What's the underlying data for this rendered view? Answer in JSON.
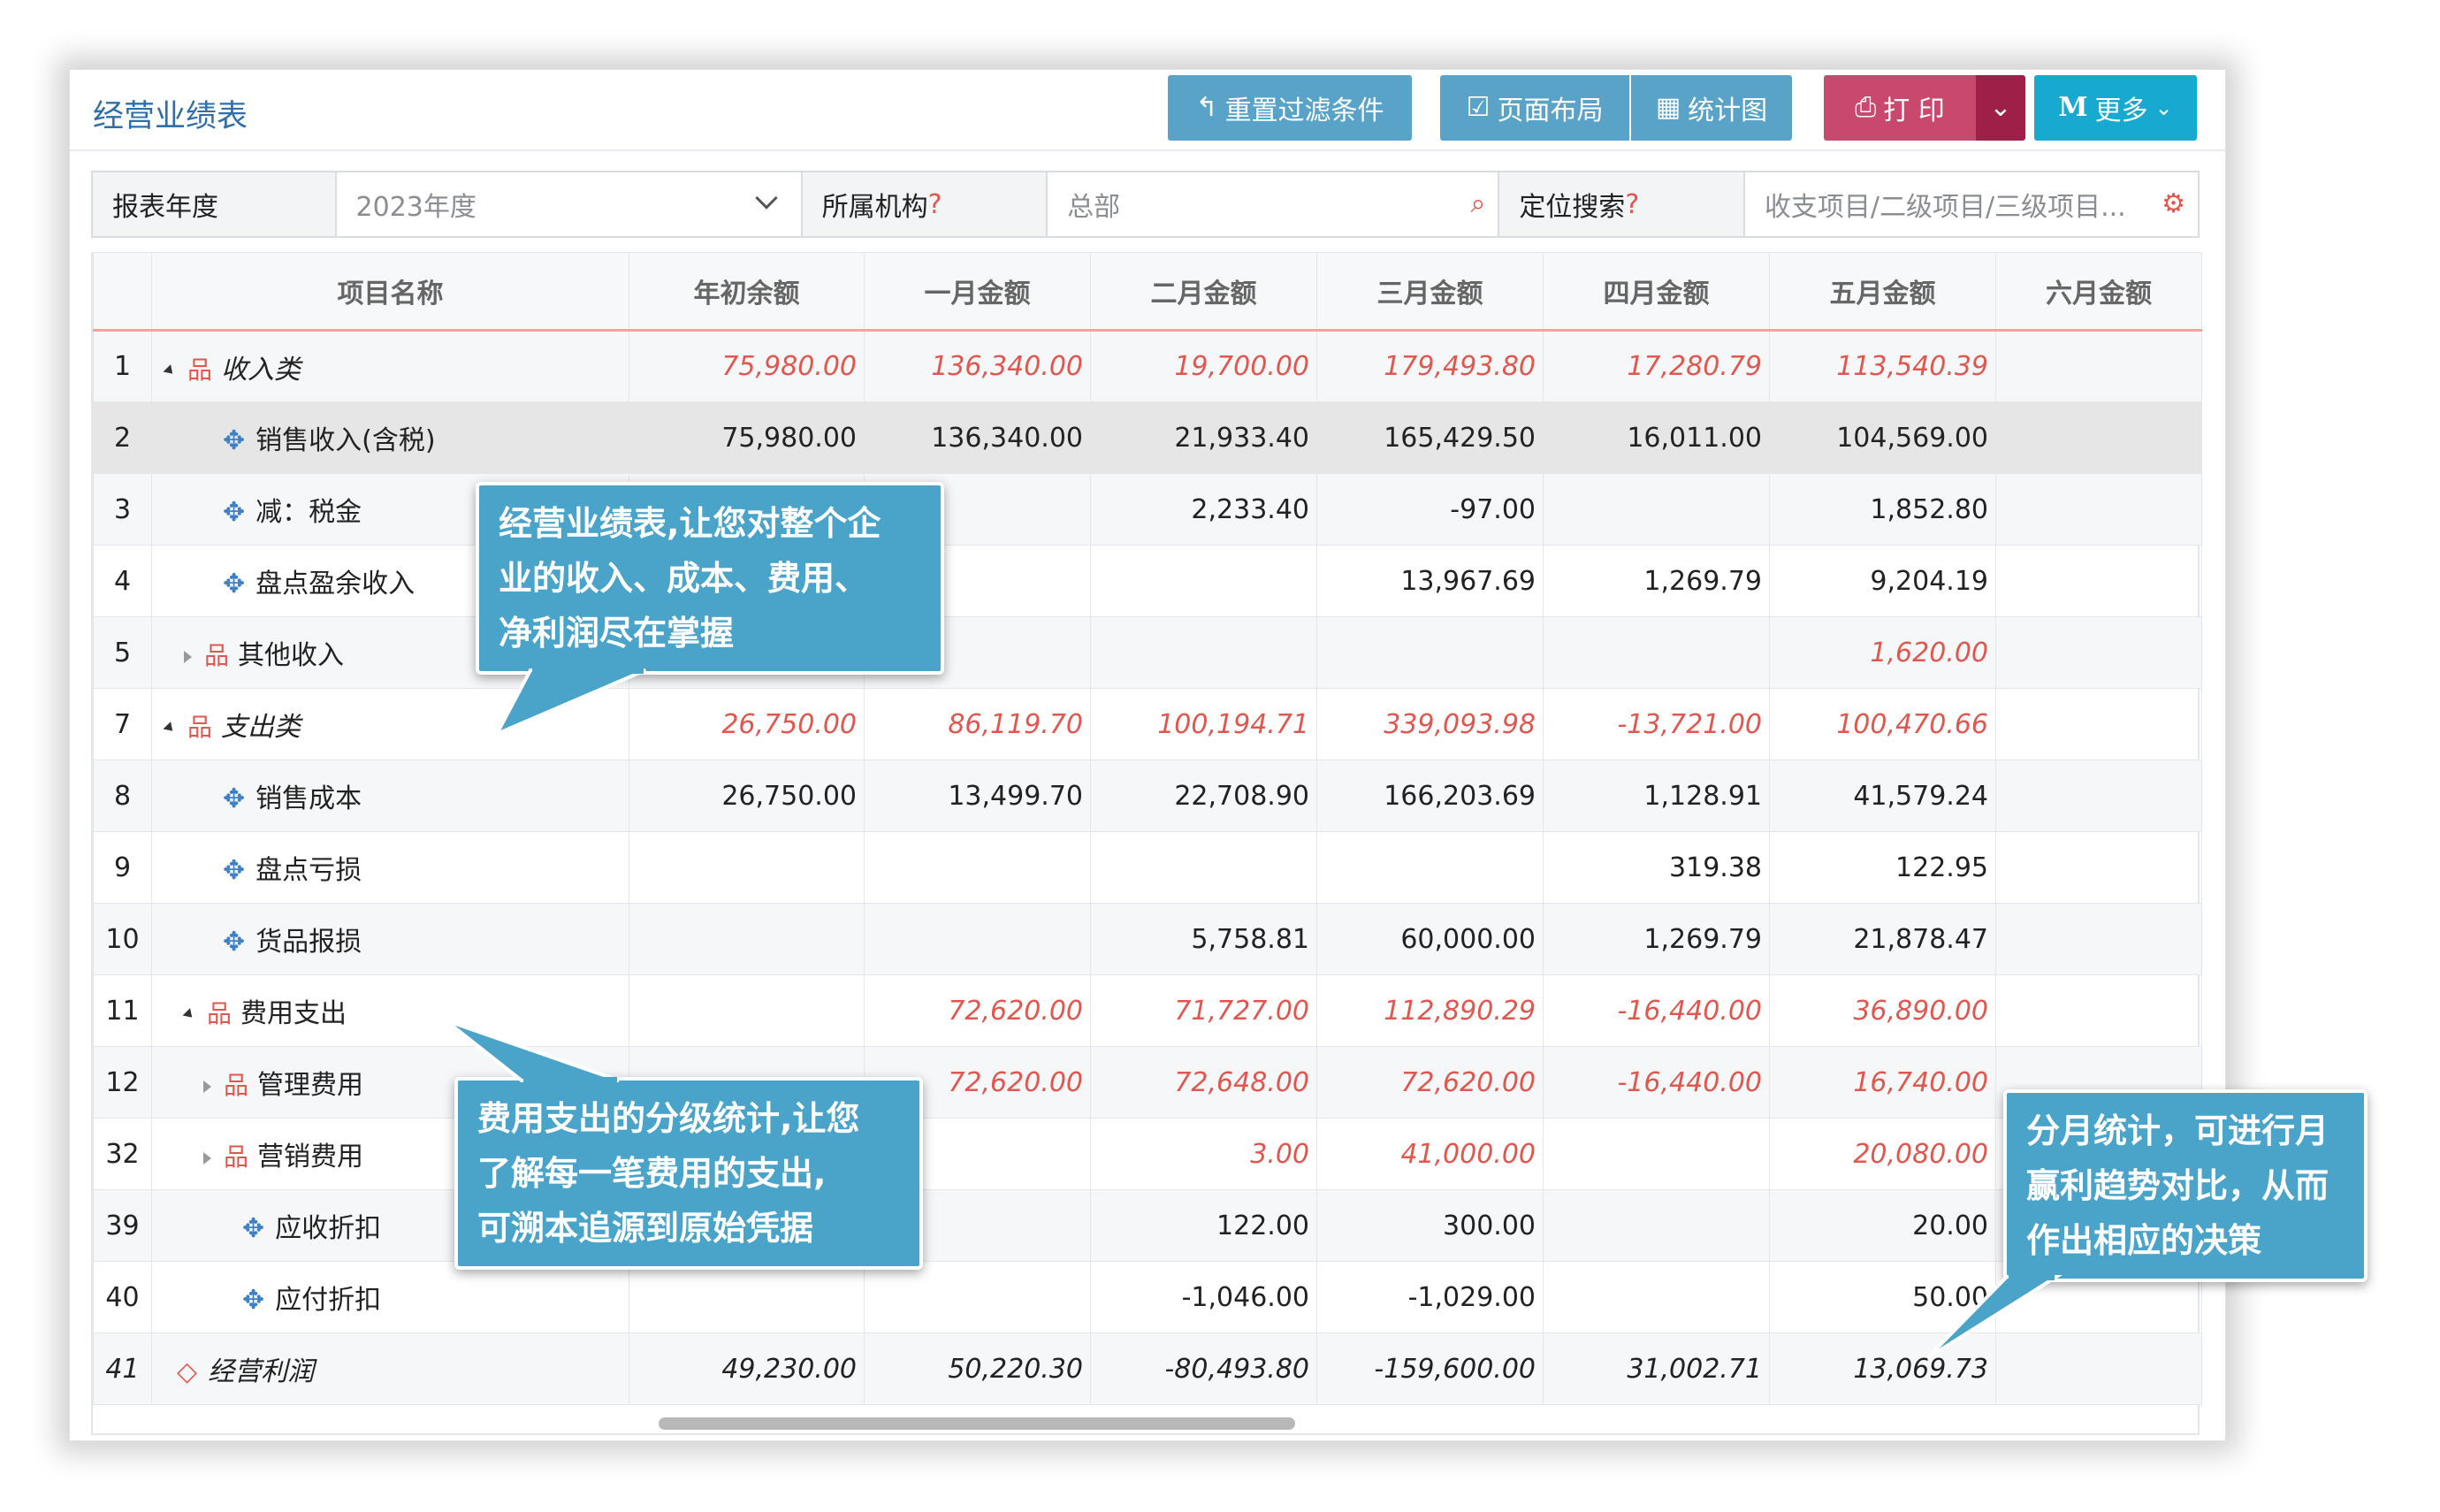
{
  "header": {
    "title": "经营业绩表",
    "buttons": {
      "reset_filters": "重置过滤条件",
      "page_layout": "页面布局",
      "chart": "统计图",
      "print": "打 印",
      "more": "更多"
    }
  },
  "filters": {
    "year_label": "报表年度",
    "year_value": "2023年度",
    "org_label": "所属机构",
    "org_value": "总部",
    "search_label": "定位搜索",
    "search_placeholder": "收支项目/二级项目/三级项目...",
    "question_mark": "?"
  },
  "table": {
    "columns": [
      "项目名称",
      "年初余额",
      "一月金额",
      "二月金额",
      "三月金额",
      "四月金额",
      "五月金额",
      "六月金额"
    ],
    "rows": [
      {
        "no": "1",
        "name": "收入类",
        "cells": [
          "75,980.00",
          "136,340.00",
          "19,700.00",
          "179,493.80",
          "17,280.79",
          "113,540.39",
          ""
        ]
      },
      {
        "no": "2",
        "name": "销售收入(含税)",
        "cells": [
          "75,980.00",
          "136,340.00",
          "21,933.40",
          "165,429.50",
          "16,011.00",
          "104,569.00",
          ""
        ]
      },
      {
        "no": "3",
        "name": "减：税金",
        "cells": [
          "",
          "",
          "2,233.40",
          "-97.00",
          "",
          "1,852.80",
          ""
        ]
      },
      {
        "no": "4",
        "name": "盘点盈余收入",
        "cells": [
          "",
          "",
          "",
          "13,967.69",
          "1,269.79",
          "9,204.19",
          ""
        ]
      },
      {
        "no": "5",
        "name": "其他收入",
        "cells": [
          "",
          "",
          "",
          "",
          "",
          "1,620.00",
          ""
        ]
      },
      {
        "no": "7",
        "name": "支出类",
        "cells": [
          "26,750.00",
          "86,119.70",
          "100,194.71",
          "339,093.98",
          "-13,721.00",
          "100,470.66",
          ""
        ]
      },
      {
        "no": "8",
        "name": "销售成本",
        "cells": [
          "26,750.00",
          "13,499.70",
          "22,708.90",
          "166,203.69",
          "1,128.91",
          "41,579.24",
          ""
        ]
      },
      {
        "no": "9",
        "name": "盘点亏损",
        "cells": [
          "",
          "",
          "",
          "",
          "319.38",
          "122.95",
          ""
        ]
      },
      {
        "no": "10",
        "name": "货品报损",
        "cells": [
          "",
          "",
          "5,758.81",
          "60,000.00",
          "1,269.79",
          "21,878.47",
          ""
        ]
      },
      {
        "no": "11",
        "name": "费用支出",
        "cells": [
          "",
          "72,620.00",
          "71,727.00",
          "112,890.29",
          "-16,440.00",
          "36,890.00",
          ""
        ]
      },
      {
        "no": "12",
        "name": "管理费用",
        "cells": [
          "",
          "72,620.00",
          "72,648.00",
          "72,620.00",
          "-16,440.00",
          "16,740.00",
          ""
        ]
      },
      {
        "no": "32",
        "name": "营销费用",
        "cells": [
          "",
          "",
          "3.00",
          "41,000.00",
          "",
          "20,080.00",
          ""
        ]
      },
      {
        "no": "39",
        "name": "应收折扣",
        "cells": [
          "",
          "",
          "122.00",
          "300.00",
          "",
          "20.00",
          ""
        ]
      },
      {
        "no": "40",
        "name": "应付折扣",
        "cells": [
          "",
          "",
          "-1,046.00",
          "-1,029.00",
          "",
          "50.00",
          ""
        ]
      },
      {
        "no": "41",
        "name": "经营利润",
        "cells": [
          "49,230.00",
          "50,220.30",
          "-80,493.80",
          "-159,600.00",
          "31,002.71",
          "13,069.73",
          ""
        ]
      }
    ]
  },
  "callouts": {
    "c1": [
      "经营业绩表,让您对整个企",
      "业的收入、成本、费用、",
      "净利润尽在掌握"
    ],
    "c2": [
      "费用支出的分级统计,让您",
      "了解每一笔费用的支出,",
      "可溯本追源到原始凭据"
    ],
    "c3": [
      "分月统计，可进行月",
      "赢利趋势对比，从而",
      "作出相应的决策"
    ]
  },
  "colors": {
    "accent_blue": "#5aa3c8",
    "print_red": "#c9486e",
    "more_cyan": "#17a9cf",
    "negative_red": "#e0574f",
    "callout": "#4aa3c8"
  }
}
